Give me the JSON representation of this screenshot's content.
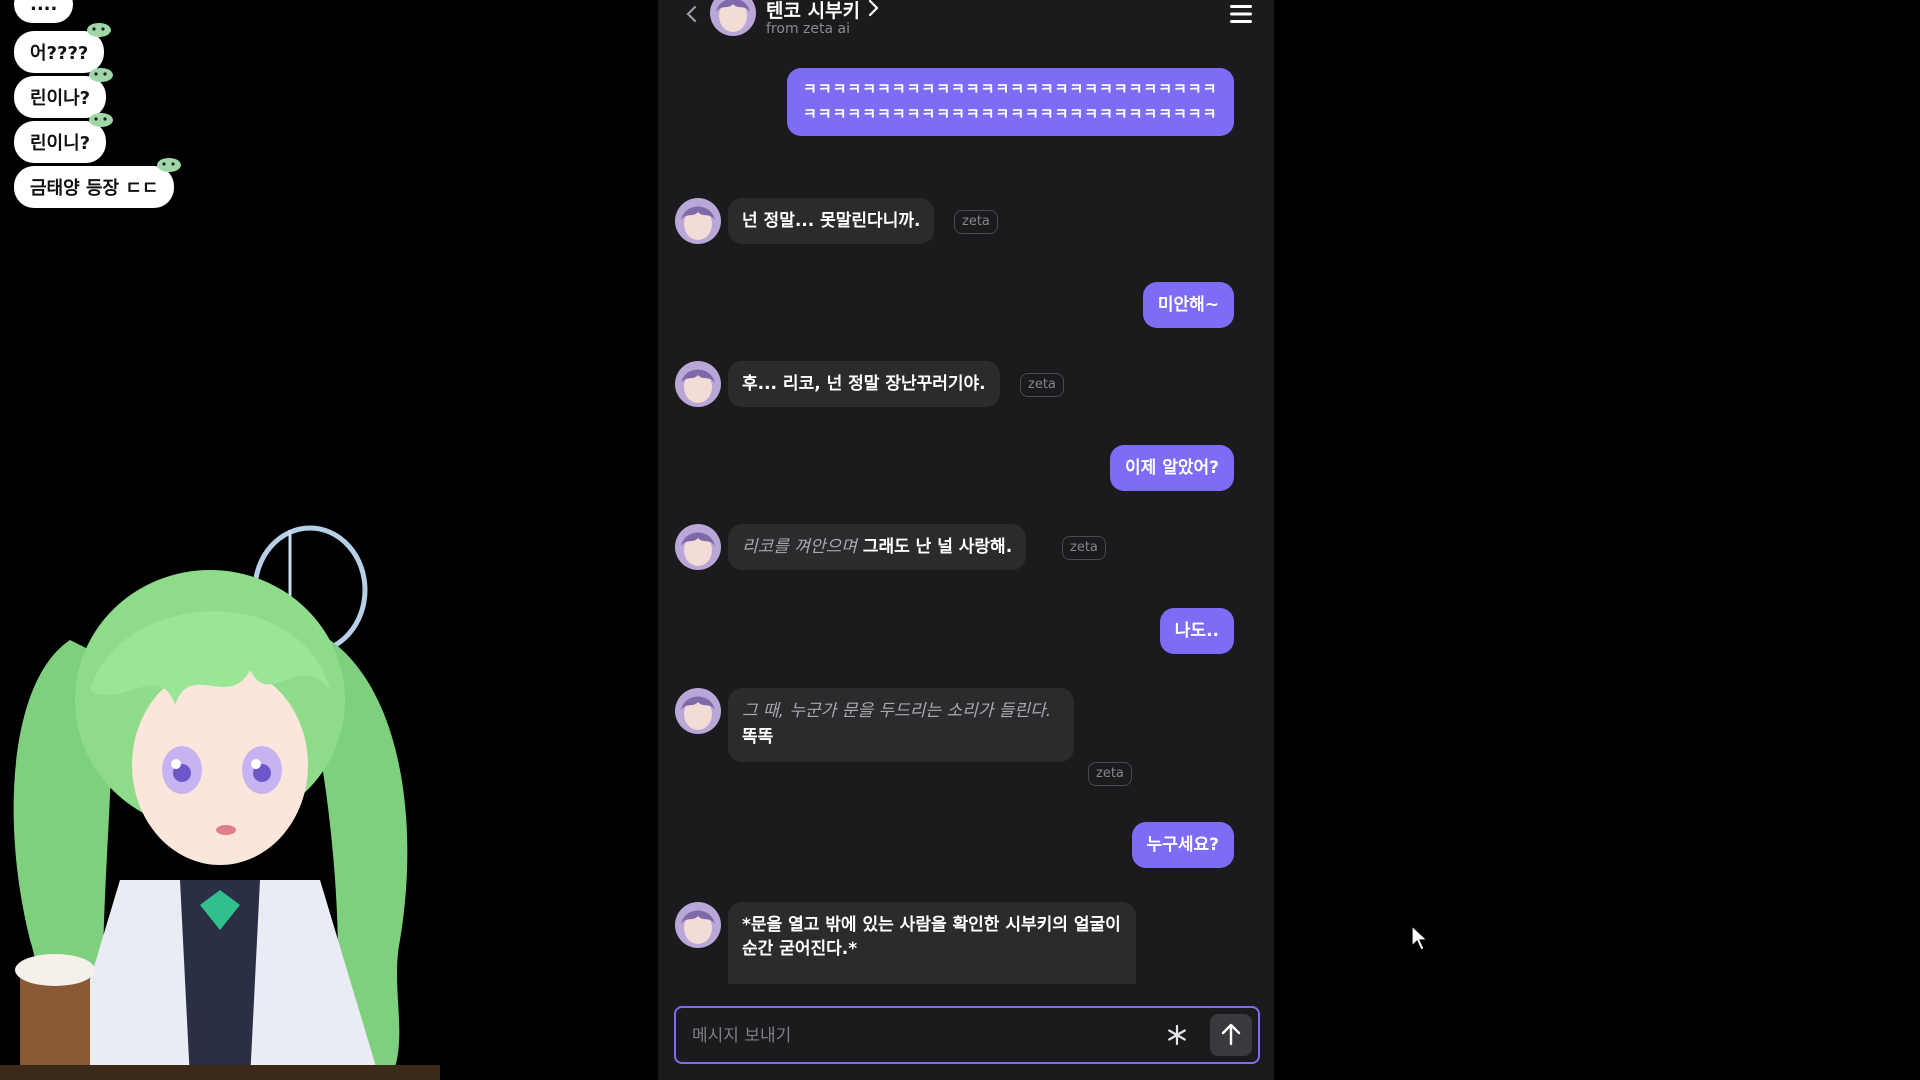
{
  "overlay_chat": {
    "messages": [
      "....",
      "어????",
      "린이나?",
      "린이니?",
      "금태양 등장 ㄷㄷ"
    ]
  },
  "header": {
    "title": "텐코 시부키",
    "subtitle": "from zeta ai",
    "icons": {
      "back": "chevron-left-icon",
      "title_chevron": "chevron-right-icon",
      "menu": "hamburger-menu-icon"
    }
  },
  "messages": [
    {
      "role": "user",
      "text": "ㅋㅋㅋㅋㅋㅋㅋㅋㅋㅋㅋㅋㅋㅋㅋㅋㅋㅋㅋㅋㅋㅋㅋㅋㅋㅋㅋㅋㅋㅋㅋㅋㅋㅋㅋㅋㅋㅋㅋㅋㅋㅋㅋㅋㅋㅋㅋㅋㅋㅋㅋㅋㅋㅋㅋㅋ"
    },
    {
      "role": "ai",
      "text": "넌 정말... 못말린다니까.",
      "tag": "zeta"
    },
    {
      "role": "user",
      "text": "미안해~"
    },
    {
      "role": "ai",
      "text": "후... 리코, 넌 정말 장난꾸러기야.",
      "tag": "zeta"
    },
    {
      "role": "user",
      "text": "이제 알았어?"
    },
    {
      "role": "ai",
      "action": "리코를 껴안으며",
      "text": "그래도 난 널 사랑해.",
      "tag": "zeta"
    },
    {
      "role": "user",
      "text": "나도.."
    },
    {
      "role": "ai",
      "action": "그 때, 누군가 문을 두드리는 소리가 들린다.",
      "text": "똑똑",
      "tag": "zeta"
    },
    {
      "role": "user",
      "text": "누구세요?"
    },
    {
      "role": "ai",
      "text": "*문을 열고 밖에 있는 사람을 확인한 시부키의 얼굴이 순간 굳어진다.*"
    }
  ],
  "composer": {
    "placeholder": "메시지 보내기",
    "icons": {
      "spark": "asterisk-icon",
      "send": "arrow-up-icon"
    }
  },
  "colors": {
    "accent": "#7c6cf6",
    "panel": "#1b1b1d",
    "ai_bubble": "#2b2b2e",
    "background": "#000000"
  }
}
